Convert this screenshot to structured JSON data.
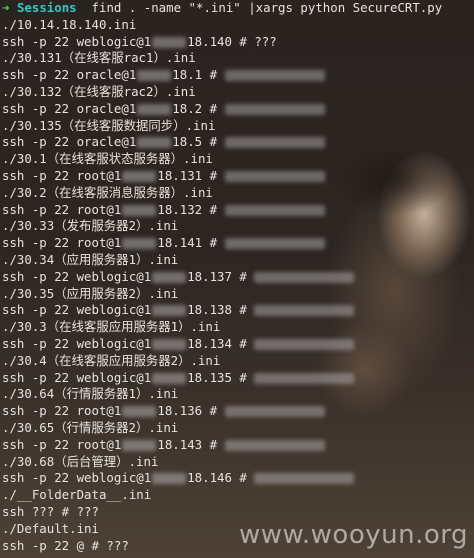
{
  "prompt": {
    "arrow": "➜",
    "directory": "Sessions",
    "command": "find . -name \"*.ini\" |xargs python SecureCRT.py"
  },
  "lines": [
    {
      "pre": "./10.14.18.140.ini"
    },
    {
      "pre": "ssh -p 22 weblogic@1",
      "mid": "18.140 # ???"
    },
    {
      "pre": "./30.131（在线客服rac1）.ini"
    },
    {
      "pre": "ssh -p 22 oracle@1",
      "mid": "18.1 # ",
      "pass": true
    },
    {
      "pre": "./30.132（在线客服rac2）.ini"
    },
    {
      "pre": "ssh -p 22 oracle@1",
      "mid": "18.2 # ",
      "pass": true
    },
    {
      "pre": "./30.135（在线客服数据同步）.ini"
    },
    {
      "pre": "ssh -p 22 oracle@1",
      "mid": "18.5 # ",
      "pass": true
    },
    {
      "pre": "./30.1（在线客服状态服务器）.ini"
    },
    {
      "pre": "ssh -p 22 root@1",
      "mid": "18.131 # ",
      "pass": true
    },
    {
      "pre": "./30.2（在线客服消息服务器）.ini"
    },
    {
      "pre": "ssh -p 22 root@1",
      "mid": "18.132 # ",
      "pass": true
    },
    {
      "pre": "./30.33（发布服务器2）.ini"
    },
    {
      "pre": "ssh -p 22 root@1",
      "mid": "18.141 # ",
      "pass": true
    },
    {
      "pre": "./30.34（应用服务器1）.ini"
    },
    {
      "pre": "ssh -p 22 weblogic@1",
      "mid": "18.137 # ",
      "pass": true
    },
    {
      "pre": "./30.35（应用服务器2）.ini"
    },
    {
      "pre": "ssh -p 22 weblogic@1",
      "mid": "18.138 # ",
      "pass": true
    },
    {
      "pre": "./30.3（在线客服应用服务器1）.ini"
    },
    {
      "pre": "ssh -p 22 weblogic@1",
      "mid": "18.134 # ",
      "pass": true
    },
    {
      "pre": "./30.4（在线客服应用服务器2）.ini"
    },
    {
      "pre": "ssh -p 22 weblogic@1",
      "mid": "18.135 # ",
      "pass": true
    },
    {
      "pre": "./30.64（行情服务器1）.ini"
    },
    {
      "pre": "ssh -p 22 root@1",
      "mid": "18.136 # ",
      "pass": true
    },
    {
      "pre": "./30.65（行情服务器2）.ini"
    },
    {
      "pre": "ssh -p 22 root@1",
      "mid": "18.143 # ",
      "pass": true
    },
    {
      "pre": "./30.68（后台管理）.ini"
    },
    {
      "pre": "ssh -p 22 weblogic@1",
      "mid": "18.146 # ",
      "pass": true
    },
    {
      "pre": "./__FolderData__.ini"
    },
    {
      "pre": "ssh ??? # ???"
    },
    {
      "pre": "./Default.ini"
    },
    {
      "pre": "ssh -p 22 @ # ???"
    }
  ],
  "watermark": "www.wooyun.org",
  "colors": {
    "background": "#2b2522",
    "text": "#e6e4df",
    "arrow": "#55d14b",
    "directory": "#35c6c6"
  }
}
